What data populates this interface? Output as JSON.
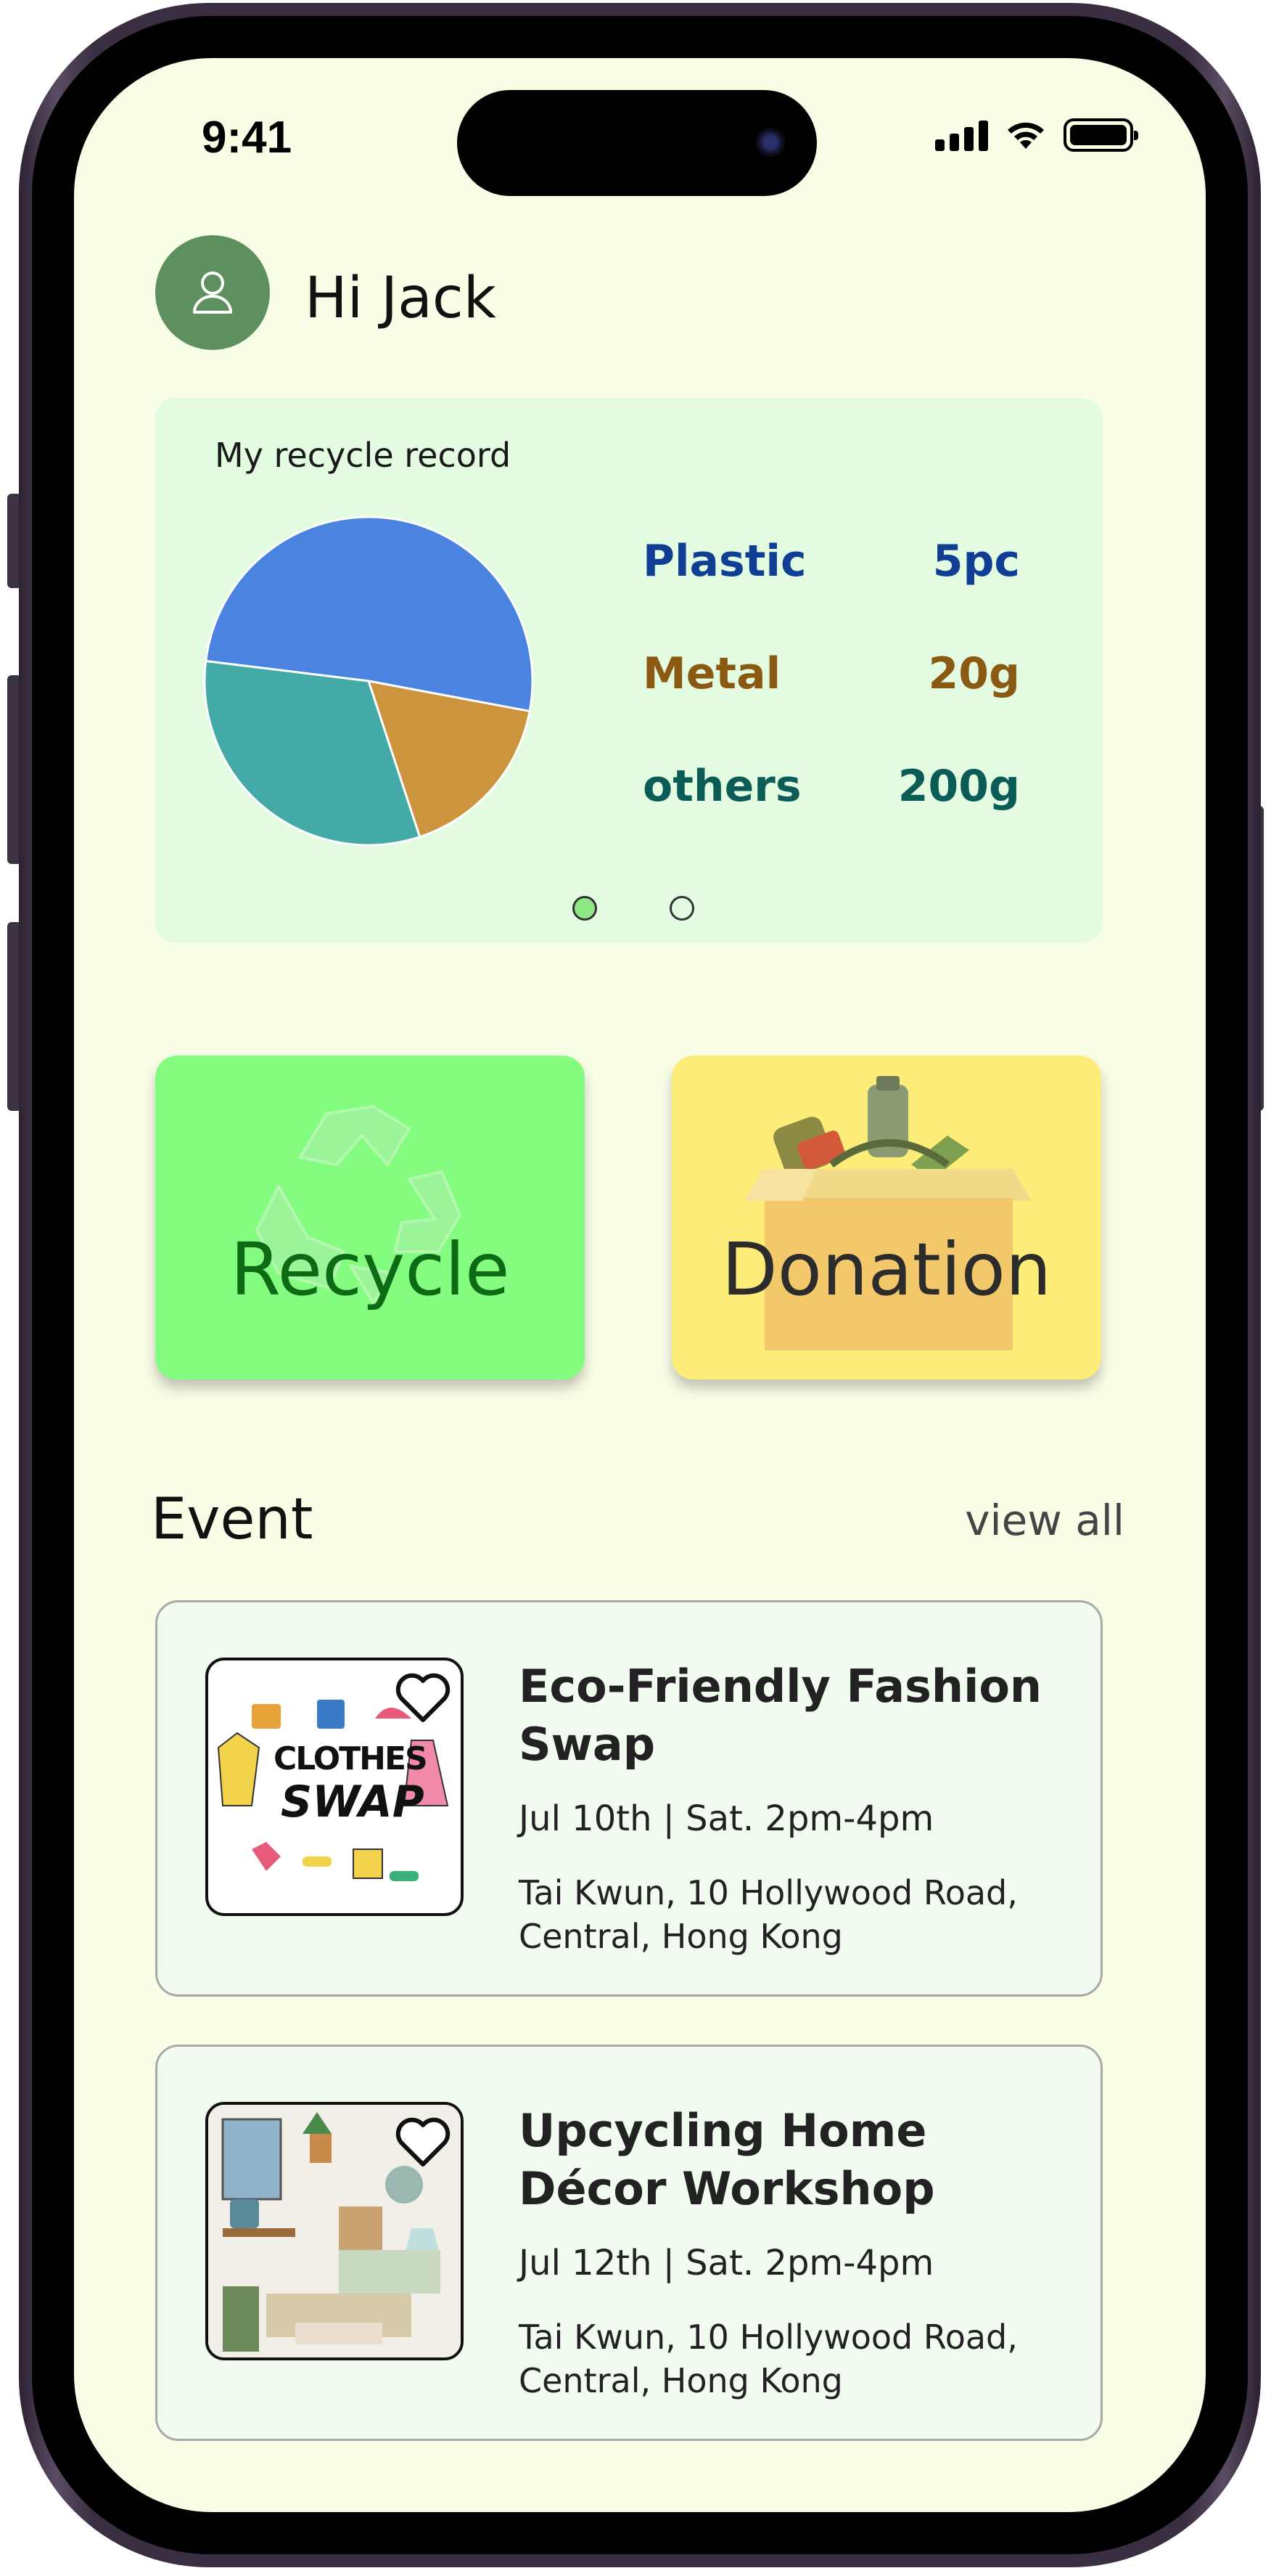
{
  "status_bar": {
    "time": "9:41"
  },
  "header": {
    "greeting": "Hi Jack"
  },
  "record": {
    "title": "My recycle record",
    "items": [
      {
        "name": "Plastic",
        "value": "5pc",
        "color": "#0f3e94"
      },
      {
        "name": "Metal",
        "value": "20g",
        "color": "#8a5a12"
      },
      {
        "name": "others",
        "value": "200g",
        "color": "#0b5b57"
      }
    ],
    "pie_colors": [
      "#4a83e0",
      "#cc943d",
      "#43aaa8"
    ],
    "page_indicator": {
      "count": 2,
      "active": 0
    }
  },
  "chart_data": {
    "type": "pie",
    "title": "My recycle record",
    "labels": [
      "Plastic",
      "Metal",
      "others"
    ],
    "values": [
      51,
      17,
      32
    ],
    "value_units": "percent of pie (estimated)"
  },
  "actions": {
    "recycle_label": "Recycle",
    "donation_label": "Donation"
  },
  "events": {
    "title": "Event",
    "view_all": "view all",
    "items": [
      {
        "title": "Eco-Friendly Fashion Swap",
        "date": "Jul 10th |  Sat. 2pm-4pm",
        "address": "Tai Kwun, 10 Hollywood Road, Central, Hong Kong",
        "thumb_text_1": "CLOTHES",
        "thumb_text_2": "SWAP"
      },
      {
        "title": "Upcycling Home Décor Workshop",
        "date": "Jul 12th |  Sat. 2pm-4pm",
        "address": "Tai Kwun, 10 Hollywood Road, Central, Hong Kong"
      }
    ]
  },
  "colors": {
    "screen_bg": "#f8fde6",
    "card_bg": "#e2fbe1",
    "recycle_tile": "#84fc7f",
    "donation_tile": "#fdec77",
    "avatar_bg": "#5e8f5e"
  }
}
